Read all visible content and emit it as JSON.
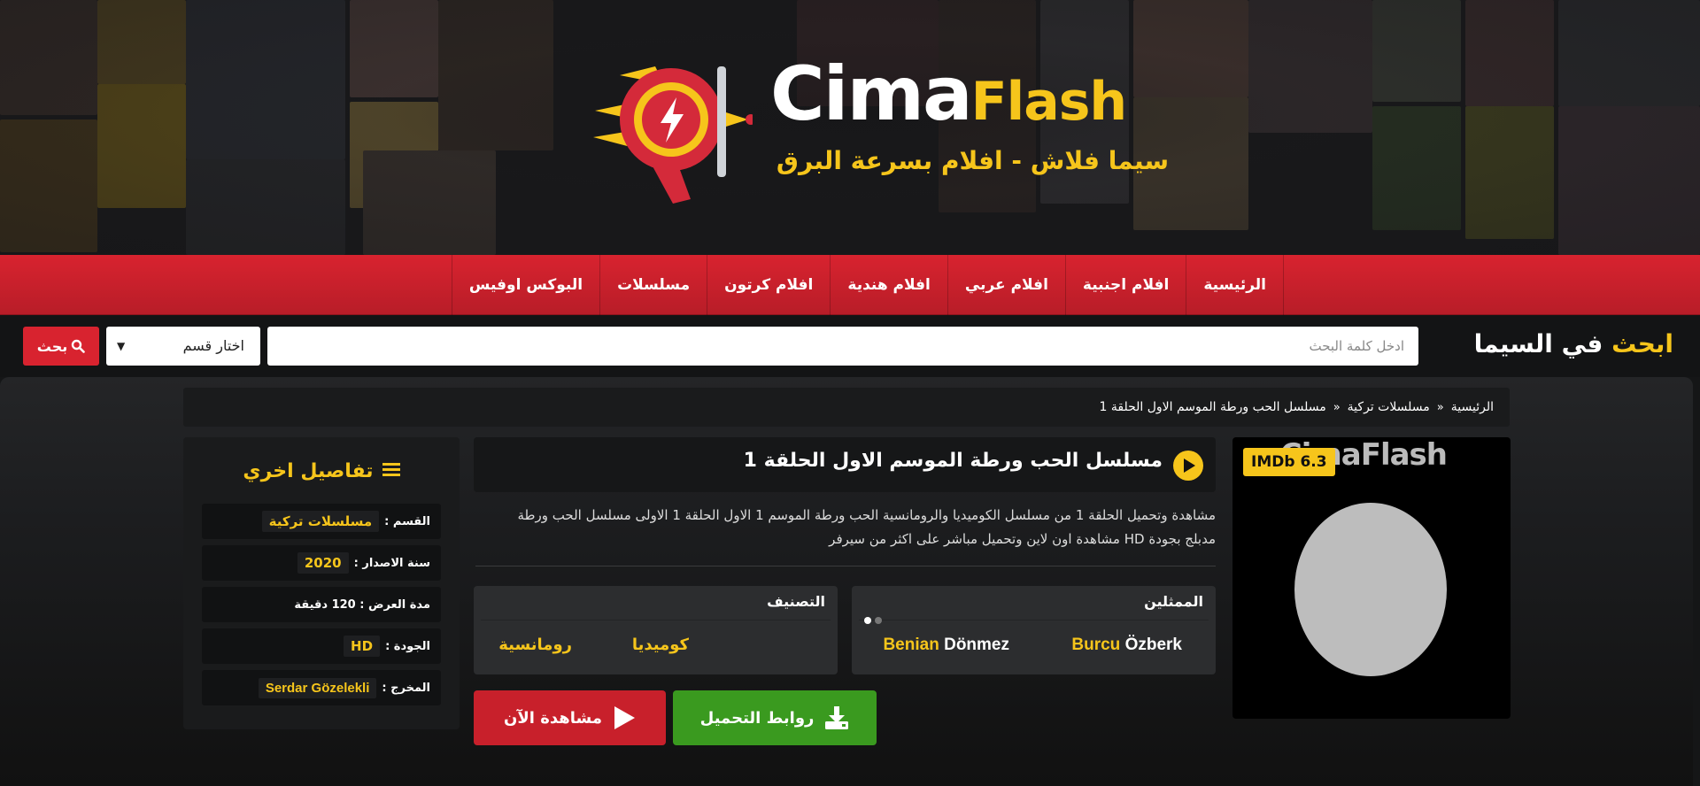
{
  "logo": {
    "cima": "Cima",
    "flash": "Flash",
    "tagline": "سيما فلاش - افلام بسرعة البرق"
  },
  "nav": {
    "items": [
      "الرئيسية",
      "افلام اجنبية",
      "افلام عربي",
      "افلام هندية",
      "افلام كرتون",
      "مسلسلات",
      "البوكس اوفيس"
    ]
  },
  "search": {
    "title_accent": "ابحث",
    "title_rest": " في السيما",
    "placeholder": "ادخل كلمة البحث",
    "category": "اختار قسم",
    "button": "بحث"
  },
  "breadcrumb": [
    "الرئيسية",
    "مسلسلات تركية",
    "مسلسل الحب ورطة الموسم الاول الحلقة 1"
  ],
  "poster": {
    "watermark": "CimaFlash",
    "imdb": "IMDb 6.3"
  },
  "title": "مسلسل الحب ورطة الموسم الاول الحلقة 1",
  "description": "مشاهدة وتحميل الحلقة 1 من مسلسل الكوميديا والرومانسية الحب ورطة الموسم 1 الاول الحلقة 1 الاولى مسلسل الحب ورطة مدبلج بجودة HD مشاهدة اون لاين وتحميل مباشر على اكثر من سيرفر",
  "actors": {
    "heading": "الممثلين",
    "list": [
      {
        "first": "Burcu",
        "last": "Özberk"
      },
      {
        "first": "Benian",
        "last": "Dönmez"
      }
    ]
  },
  "genres": {
    "heading": "التصنيف",
    "list": [
      "كوميديا",
      "رومانسية"
    ]
  },
  "buttons": {
    "download": "روابط التحميل",
    "watch": "مشاهدة الآن"
  },
  "details": {
    "heading": "تفاصيل اخري",
    "section_label": "القسم :",
    "section_value": "مسلسلات تركية",
    "year_label": "سنة الاصدار :",
    "year_value": "2020",
    "duration": "مدة العرض : 120 دقيقة",
    "quality_label": "الجودة :",
    "quality_value": "HD",
    "director_label": "المخرج :",
    "director_value": "Serdar Gözelekli"
  },
  "colors": {
    "accent": "#f6c51b",
    "nav_red": "#d8232f",
    "download_green": "#3a9a1f",
    "watch_red": "#c8202b"
  }
}
